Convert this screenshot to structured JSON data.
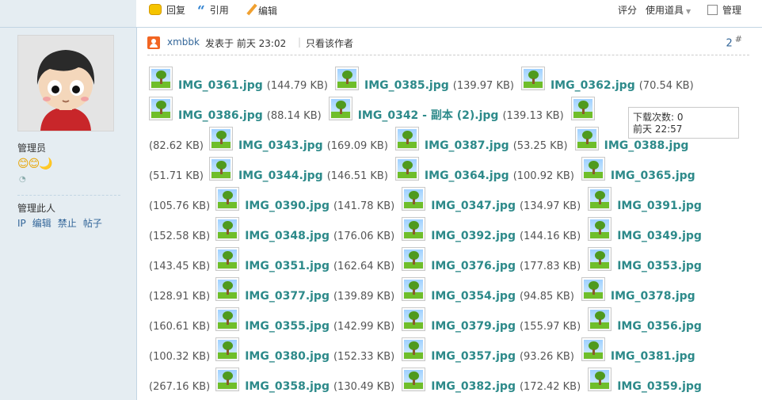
{
  "toolbar": {
    "reply": "回复",
    "quote": "引用",
    "edit": "编辑",
    "rate": "评分",
    "use_tool": "使用道具",
    "manage": "管理"
  },
  "user": {
    "role": "管理员",
    "medals": "😊😊🌙",
    "manage_title": "管理此人",
    "manage_links": [
      "IP",
      "编辑",
      "禁止",
      "帖子"
    ]
  },
  "post": {
    "author": "xmbbk",
    "posted": "发表于 前天 23:02",
    "only_author": "只看该作者",
    "floor": "2",
    "floor_mark": "#"
  },
  "tooltip": {
    "downloads": "下载次数: 0",
    "time": "前天 22:57"
  },
  "attachments": [
    [
      {
        "size_before": "",
        "name": "IMG_0361.jpg",
        "size": "(144.79 KB)"
      },
      {
        "name": "IMG_0385.jpg",
        "size": "(139.97 KB)"
      },
      {
        "name": "IMG_0362.jpg",
        "size": "(70.54 KB)"
      }
    ],
    [
      {
        "size_before": "",
        "name": "IMG_0386.jpg",
        "size": "(88.14 KB)"
      },
      {
        "name": "IMG_0342 - 副本 (2).jpg",
        "size": "(139.13 KB)"
      },
      {
        "name": "",
        "size": ""
      }
    ],
    [
      {
        "size_before": "(82.62 KB)",
        "name": "IMG_0343.jpg",
        "size": "(169.09 KB)"
      },
      {
        "name": "IMG_0387.jpg",
        "size": "(53.25 KB)"
      },
      {
        "name": "IMG_0388.jpg",
        "size": ""
      }
    ],
    [
      {
        "size_before": "(51.71 KB)",
        "name": "IMG_0344.jpg",
        "size": "(146.51 KB)"
      },
      {
        "name": "IMG_0364.jpg",
        "size": "(100.92 KB)"
      },
      {
        "name": "IMG_0365.jpg",
        "size": ""
      }
    ],
    [
      {
        "size_before": "(105.76 KB)",
        "name": "IMG_0390.jpg",
        "size": "(141.78 KB)"
      },
      {
        "name": "IMG_0347.jpg",
        "size": "(134.97 KB)"
      },
      {
        "name": "IMG_0391.jpg",
        "size": ""
      }
    ],
    [
      {
        "size_before": "(152.58 KB)",
        "name": "IMG_0348.jpg",
        "size": "(176.06 KB)"
      },
      {
        "name": "IMG_0392.jpg",
        "size": "(144.16 KB)"
      },
      {
        "name": "IMG_0349.jpg",
        "size": ""
      }
    ],
    [
      {
        "size_before": "(143.45 KB)",
        "name": "IMG_0351.jpg",
        "size": "(162.64 KB)"
      },
      {
        "name": "IMG_0376.jpg",
        "size": "(177.83 KB)"
      },
      {
        "name": "IMG_0353.jpg",
        "size": ""
      }
    ],
    [
      {
        "size_before": "(128.91 KB)",
        "name": "IMG_0377.jpg",
        "size": "(139.89 KB)"
      },
      {
        "name": "IMG_0354.jpg",
        "size": "(94.85 KB)"
      },
      {
        "name": "IMG_0378.jpg",
        "size": ""
      }
    ],
    [
      {
        "size_before": "(160.61 KB)",
        "name": "IMG_0355.jpg",
        "size": "(142.99 KB)"
      },
      {
        "name": "IMG_0379.jpg",
        "size": "(155.97 KB)"
      },
      {
        "name": "IMG_0356.jpg",
        "size": ""
      }
    ],
    [
      {
        "size_before": "(100.32 KB)",
        "name": "IMG_0380.jpg",
        "size": "(152.33 KB)"
      },
      {
        "name": "IMG_0357.jpg",
        "size": "(93.26 KB)"
      },
      {
        "name": "IMG_0381.jpg",
        "size": ""
      }
    ],
    [
      {
        "size_before": "(267.16 KB)",
        "name": "IMG_0358.jpg",
        "size": "(130.49 KB)"
      },
      {
        "name": "IMG_0382.jpg",
        "size": "(172.42 KB)"
      },
      {
        "name": "IMG_0359.jpg",
        "size": ""
      }
    ]
  ]
}
